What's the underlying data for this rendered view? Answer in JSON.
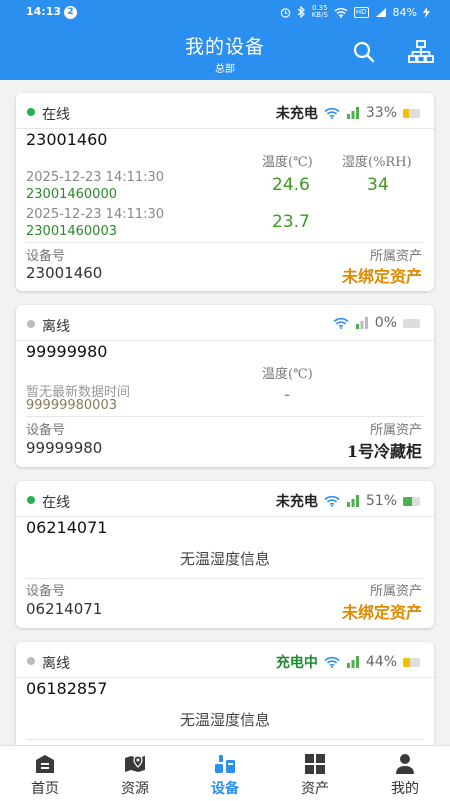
{
  "status_bar": {
    "time": "14:13",
    "notification_count": "2",
    "net_speed_top": "0.35",
    "net_speed_bottom": "KB/S",
    "hd": "HD",
    "battery": "84%"
  },
  "header": {
    "title": "我的设备",
    "subtitle": "总部"
  },
  "labels": {
    "temperature": "温度(℃)",
    "humidity": "湿度(%RH)",
    "device_no": "设备号",
    "asset": "所属资产",
    "no_info": "无温湿度信息"
  },
  "colors": {
    "primary": "#2b8ff0",
    "online": "#22b14c",
    "offline": "#bbbbbb",
    "unbound": "#e08a00",
    "wifi": "#2b8ff0"
  },
  "devices": [
    {
      "status": "在线",
      "charge": "未充电",
      "battery_pct": "33%",
      "battery_level": 0.33,
      "battery_color": "#f2c200",
      "id": "23001460",
      "readings": [
        {
          "time": "2025-12-23 14:11:30",
          "sensor": "23001460000",
          "temperature": "24.6",
          "humidity": "34"
        },
        {
          "time": "2025-12-23 14:11:30",
          "sensor": "23001460003",
          "temperature": "23.7"
        }
      ],
      "device_no": "23001460",
      "asset": "未绑定资产"
    },
    {
      "status": "离线",
      "charge": "",
      "battery_pct": "0%",
      "battery_level": 0,
      "battery_color": "#cccccc",
      "id": "99999980",
      "no_data_time": "暂无最新数据时间",
      "sensor": "99999980003",
      "temperature": "-",
      "device_no": "99999980",
      "asset": "1号冷藏柜"
    },
    {
      "status": "在线",
      "charge": "未充电",
      "battery_pct": "51%",
      "battery_level": 0.51,
      "battery_color": "#4caf50",
      "id": "06214071",
      "device_no": "06214071",
      "asset": "未绑定资产"
    },
    {
      "status": "离线",
      "charge": "充电中",
      "battery_pct": "44%",
      "battery_level": 0.44,
      "battery_color": "#f2c200",
      "id": "06182857"
    }
  ],
  "tabs": [
    {
      "label": "首页",
      "icon": "home-icon"
    },
    {
      "label": "资源",
      "icon": "map-pin-icon"
    },
    {
      "label": "设备",
      "icon": "device-icon",
      "active": true
    },
    {
      "label": "资产",
      "icon": "grid-icon"
    },
    {
      "label": "我的",
      "icon": "user-icon"
    }
  ]
}
